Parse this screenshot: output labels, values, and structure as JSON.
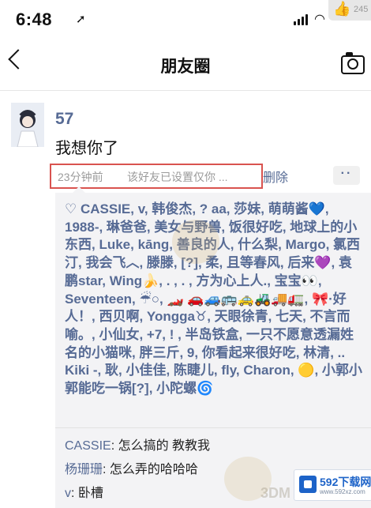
{
  "status_bar": {
    "time": "6:48",
    "badge_count": "245"
  },
  "nav": {
    "title": "朋友圈"
  },
  "post": {
    "author": "57",
    "text": "我想你了",
    "time": "23分钟前",
    "privacy": "该好友已设置仅你 ...",
    "delete_label": "删除",
    "more_label": "··"
  },
  "likes": {
    "text": "CASSIE, v, 韩俊杰, ? aa, 莎妹, 萌萌酱💙, 1988-, 琳爸爸, 美女与野兽, 饭很好吃, 地球上的小东西, Luke, kāng, 善良的人, 什么梨, Margo, 氯西汀, 我会飞︿, 滕滕, [?], 柔, 且等春风, 后来💜, 袁鹏star, Wing🍌, . , . , 方为心上人., 宝宝👀, Seventeen, ☔○, 🏎️ 🚗🚙🚌🚕🚜🚚🚛, 🎀·好人！, 西贝啊, Yongga♉, 天眼徐青, 七天, 不言而喻。, 小仙女, +7, ! , 半岛铁盒, 一只不愿意透漏姓名的小猫咪, 胖三斤, 9, 你看起来很好吃, 林清, .. Kiki -, 耿, 小佳佳, 陈睫儿, fly, Charon, 🟡, 小郭小郭能吃一锅[?], 小陀螺🌀"
  },
  "comments": [
    {
      "name": "CASSIE",
      "text": "怎么搞的 教教我"
    },
    {
      "name": "杨珊珊",
      "text": "怎么弄的哈哈哈"
    },
    {
      "name": "v",
      "text": "卧槽"
    }
  ],
  "watermark": {
    "text": "3DM",
    "site_name": "592下载网",
    "site_url": "www.592xz.com"
  },
  "colors": {
    "link": "#576b95",
    "highlight_box": "#d9534f",
    "likes_bg": "#f3f3f5"
  }
}
